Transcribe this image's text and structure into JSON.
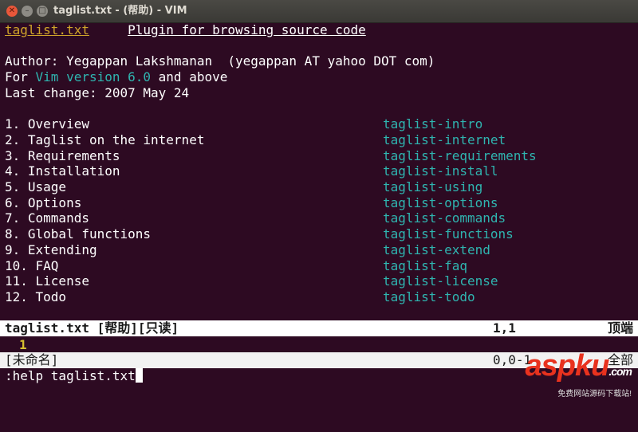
{
  "window": {
    "title": "taglist.txt - (帮助) - VIM",
    "close_glyph": "✕",
    "min_glyph": "–",
    "max_glyph": "□"
  },
  "header": {
    "file": "taglist.txt",
    "description": "Plugin for browsing source code"
  },
  "info": {
    "author": "Author: Yegappan Lakshmanan  (yegappan AT yahoo DOT com)",
    "version_prefix": "For ",
    "version_link": "Vim version 6.0",
    "version_suffix": " and above",
    "last_change": "Last change: 2007 May 24"
  },
  "toc": [
    {
      "label": "1. Overview",
      "tag": "taglist-intro"
    },
    {
      "label": "2. Taglist on the internet",
      "tag": "taglist-internet"
    },
    {
      "label": "3. Requirements",
      "tag": "taglist-requirements"
    },
    {
      "label": "4. Installation",
      "tag": "taglist-install"
    },
    {
      "label": "5. Usage",
      "tag": "taglist-using"
    },
    {
      "label": "6. Options",
      "tag": "taglist-options"
    },
    {
      "label": "7. Commands",
      "tag": "taglist-commands"
    },
    {
      "label": "8. Global functions",
      "tag": "taglist-functions"
    },
    {
      "label": "9. Extending",
      "tag": "taglist-extend"
    },
    {
      "label": "10. FAQ",
      "tag": "taglist-faq"
    },
    {
      "label": "11. License",
      "tag": "taglist-license"
    },
    {
      "label": "12. Todo",
      "tag": "taglist-todo"
    }
  ],
  "status_help": {
    "name": "taglist.txt [帮助][只读]",
    "position": "1,1",
    "percent": "顶端"
  },
  "lower_window": {
    "line_number": "1"
  },
  "status_unnamed": {
    "name": "[未命名]",
    "position": "0,0-1",
    "percent": "全部"
  },
  "command_line": ":help taglist.txt",
  "watermark": {
    "main": "aspku",
    "tld": ".com",
    "sub": "免费网站源码下载站!"
  },
  "colors": {
    "background": "#2d0a22",
    "link": "#2fb5b0",
    "header_file": "#d0a52a",
    "status_bg": "#ffffff"
  }
}
